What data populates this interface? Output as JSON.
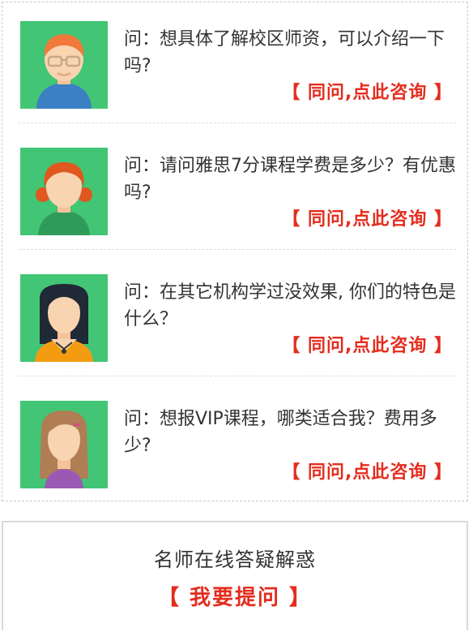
{
  "colors": {
    "accent_red": "#e42d1e",
    "avatar_bg": "#42c575",
    "divider": "#dddddd"
  },
  "qa": {
    "items": [
      {
        "question": "问：想具体了解校区师资，可以介绍一下吗?",
        "consult_label": "【 同问,点此咨询 】",
        "avatar_icon": "boy-glasses-icon"
      },
      {
        "question": "问：请问雅思7分课程学费是多少？有优惠吗?",
        "consult_label": "【 同问,点此咨询 】",
        "avatar_icon": "girl-red-hair-icon"
      },
      {
        "question": "问：在其它机构学过没效果, 你们的特色是什么？",
        "consult_label": "【 同问,点此咨询 】",
        "avatar_icon": "woman-black-hair-icon"
      },
      {
        "question": "问：想报VIP课程，哪类适合我？费用多少?",
        "consult_label": "【 同问,点此咨询 】",
        "avatar_icon": "girl-long-hair-icon"
      }
    ]
  },
  "ask": {
    "title": "名师在线答疑解惑",
    "button_label": "【 我要提问 】"
  }
}
